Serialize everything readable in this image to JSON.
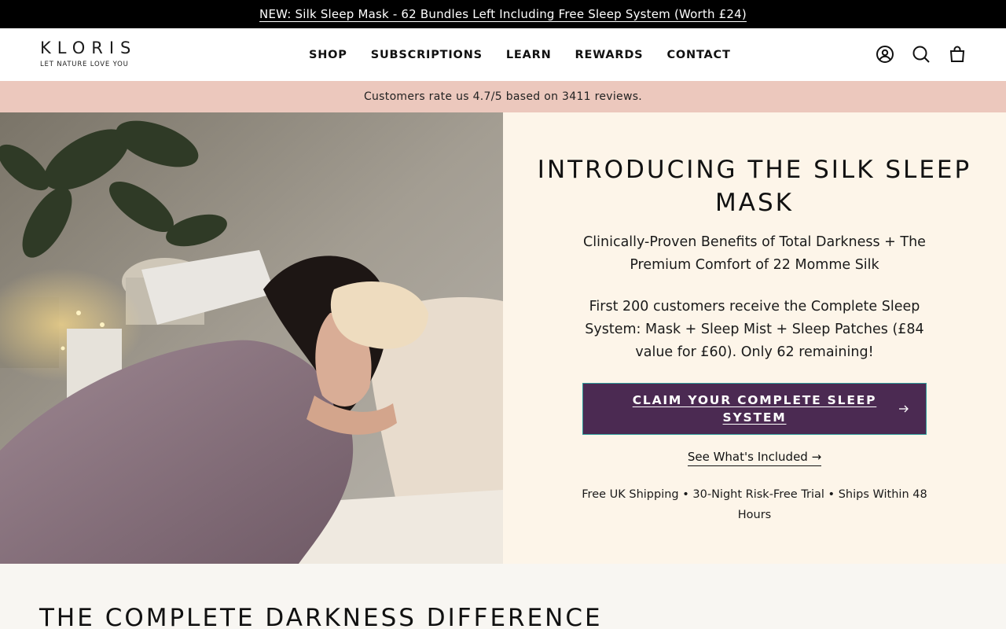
{
  "announcement": {
    "text": "NEW: Silk Sleep Mask - 62 Bundles Left Including Free Sleep System (Worth £24)"
  },
  "header": {
    "logo": {
      "word": "KLORIS",
      "tagline": "LET NATURE LOVE YOU"
    },
    "nav": [
      "SHOP",
      "SUBSCRIPTIONS",
      "LEARN",
      "REWARDS",
      "CONTACT"
    ],
    "icons": [
      "account-icon",
      "search-icon",
      "cart-icon"
    ]
  },
  "rating_bar": {
    "text": "Customers rate us 4.7/5 based on 3411 reviews."
  },
  "hero": {
    "title": "INTRODUCING THE SILK SLEEP MASK",
    "subtitle": "Clinically-Proven Benefits of Total Darkness + The Premium Comfort of 22 Momme Silk",
    "offer": "First 200 customers receive the Complete Sleep System: Mask + Sleep Mist + Sleep Patches (£84 value for £60). Only 62 remaining!",
    "cta": "CLAIM YOUR COMPLETE SLEEP SYSTEM",
    "secondary_link": "See What's Included →",
    "shipping": "Free UK Shipping • 30-Night Risk-Free Trial • Ships Within 48 Hours"
  },
  "next_section": {
    "title": "THE COMPLETE DARKNESS DIFFERENCE"
  },
  "colors": {
    "announcement_bg": "#000000",
    "rating_bg": "#ecc8bd",
    "hero_panel_bg": "#fdf5e9",
    "cta_bg": "#4b2a52",
    "page_bg": "#f8f6f2"
  }
}
